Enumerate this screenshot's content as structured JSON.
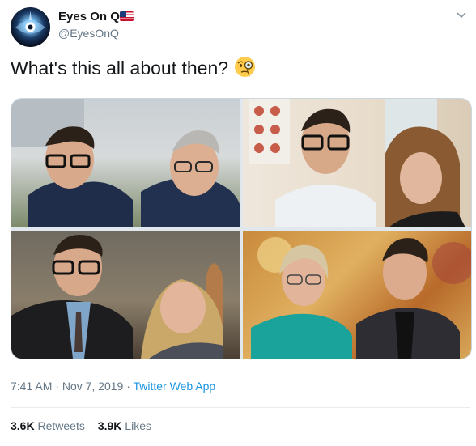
{
  "author": {
    "display_name": "Eyes On Q",
    "handle": "@EyesOnQ",
    "flag_icon": "us-flag-icon",
    "avatar_icon": "glowing-eye-avatar"
  },
  "tweet": {
    "text": "What's this all about then?",
    "emoji": "face-with-monocle-icon"
  },
  "meta": {
    "time": "7:41 AM",
    "separator": "·",
    "date": "Nov 7, 2019",
    "source": "Twitter Web App"
  },
  "stats": {
    "retweets_count": "3.6K",
    "retweets_label": "Retweets",
    "likes_count": "3.9K",
    "likes_label": "Likes"
  },
  "colors": {
    "link": "#1b95e0",
    "secondary_text": "#657786",
    "divider": "#e6ecf0"
  }
}
